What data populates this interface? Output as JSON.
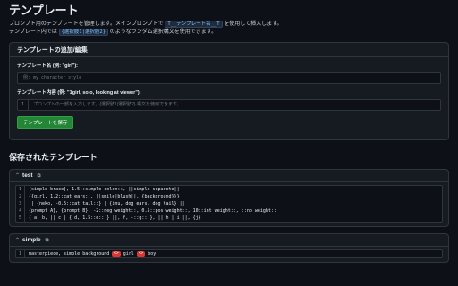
{
  "page": {
    "title": "テンプレート",
    "desc_line1_pre": "プロンプト用のテンプレートを管理します。メインプロンプトで",
    "desc_line1_code": "T__テンプレート名__T",
    "desc_line1_post": "を使用して挿入します。",
    "desc_line2_pre": "テンプレート内では",
    "desc_line2_code": "{選択肢1|選択肢2}",
    "desc_line2_post": "のようなランダム選択構文を使用できます。"
  },
  "add_panel": {
    "title": "テンプレートの追加/編集",
    "name_label": "テンプレート名 (例: \"girl\"):",
    "name_placeholder": "例: my_character_style",
    "content_label": "テンプレート内容 (例: \"1girl, solo, looking at viewer\"):",
    "content_line_no": "1",
    "content_placeholder": "プロンプトの一部を入力します。{選択肢1|選択肢2} 構文を使用できます。",
    "save_label": "テンプレートを保存"
  },
  "saved": {
    "title": "保存されたテンプレート",
    "templates": [
      {
        "name": "test",
        "lines": [
          "{simple brace}, 1.5::simple colon::, ||simple separete||",
          "{{girl, 1.2::cat ears::, ||smile|blush||, {background}}}",
          "|| {neko, -0.5::cat tail::} | {inu, dog ears, dog tail} ||",
          "{prompt A}, {prompt B}, -2::neg weight::, 0.5::pos weight::, 10::int weight::, ::no weight::",
          "{ a, b, || c | { d, 1.5::e:: } ||, f, -::g:: }, || h | i ||, {j}"
        ],
        "line_numbers": [
          "1",
          "2",
          "3",
          "4",
          "5"
        ]
      },
      {
        "name": "simple",
        "line_numbers": [
          "1"
        ],
        "line_pre": "masterpiece, simple background ",
        "chip1": "<>",
        "line_mid": " girl ",
        "chip2": "<>",
        "line_post": " boy"
      }
    ]
  },
  "icons": {
    "collapse": "chevron-up-icon",
    "copy": "copy-icon"
  },
  "colors": {
    "background": "#0d1117",
    "panel": "#161b22",
    "accent_green": "#238636",
    "chip_red": "#da3633",
    "code_blue": "#79c0ff"
  }
}
